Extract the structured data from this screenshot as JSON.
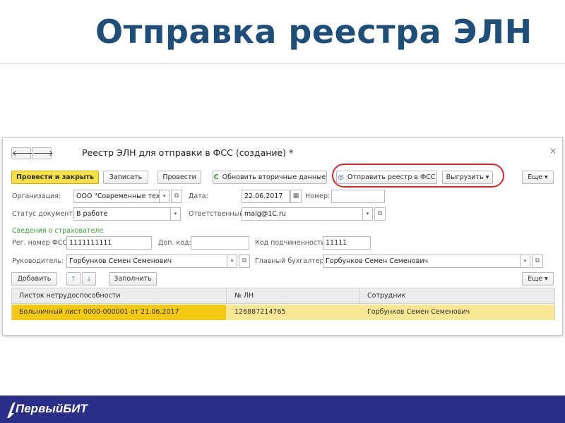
{
  "slide": {
    "title": "Отправка реестра ЭЛН"
  },
  "window": {
    "title": "Реестр ЭЛН для отправки в ФСС (создание) *",
    "back_icon": "🡐",
    "forward_icon": "🡒",
    "close_icon": "×"
  },
  "toolbar": {
    "post_close": "Провести и закрыть",
    "save": "Записать",
    "post": "Провести",
    "refresh_icon": "C",
    "refresh": "Обновить вторичные данные",
    "send_icon": "◎",
    "send": "Отправить реестр в ФСС",
    "export": "Выгрузить",
    "export_arrow": "▾",
    "more": "Еще",
    "more_arrow": "▾"
  },
  "form": {
    "org_label": "Организация:",
    "org_value": "ООО \"Современные техн",
    "date_label": "Дата:",
    "date_value": "22.06.2017",
    "number_label": "Номер:",
    "number_value": "",
    "status_label": "Статус документа:",
    "status_value": "В работе",
    "responsible_label": "Ответственный:",
    "responsible_value": "malg@1C.ru",
    "insurer_section": "Сведения о страхователе",
    "reg_label": "Рег. номер ФСС:",
    "reg_value": "1111111111",
    "extra_code_label": "Доп. код:",
    "extra_code_value": "",
    "sub_code_label": "Код подчиненности:",
    "sub_code_value": "11111",
    "head_label": "Руководитель:",
    "head_value": "Горбунков Семен Семенович",
    "accountant_label": "Главный бухгалтер:",
    "accountant_value": "Горбунков Семен Семенович",
    "dropdown_glyph": "▾",
    "open_glyph": "⧉",
    "calendar_glyph": "▦"
  },
  "table_toolbar": {
    "add": "Добавить",
    "up_icon": "🡑",
    "down_icon": "🡓",
    "fill": "Заполнить",
    "more": "Еще",
    "more_arrow": "▾"
  },
  "table": {
    "headers": [
      "Листок нетрудоспособности",
      "№ ЛН",
      "Сотрудник"
    ],
    "rows": [
      [
        "Больничный лист 0000-000001 от 21.06.2017",
        "126887214765",
        "Горбунков Семен Семенович"
      ]
    ]
  },
  "footer": {
    "brand": "ПервыйБИТ"
  },
  "colors": {
    "title": "#1f4e79",
    "primary_button": "#f7e046",
    "highlight_ellipse": "#d9262c",
    "selected_row": "#f4c912",
    "row": "#f9e796",
    "footer": "#2b2e86",
    "section": "#3a9a3a"
  }
}
